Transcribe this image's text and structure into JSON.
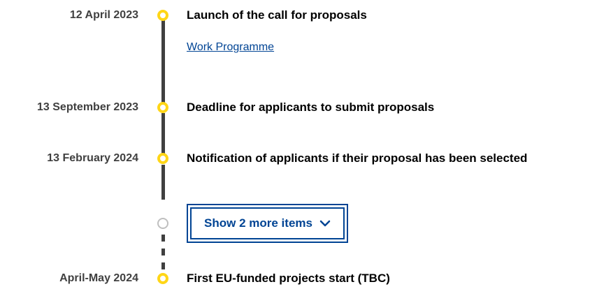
{
  "timeline": {
    "items": [
      {
        "date": "12 April 2023",
        "title": "Launch of the call for proposals",
        "link": "Work Programme"
      },
      {
        "date": "13 September 2023",
        "title": "Deadline for applicants to submit proposals"
      },
      {
        "date": "13 February 2024",
        "title": "Notification of applicants if their proposal has been selected"
      },
      {
        "date": "April-May 2024",
        "title": "First EU-funded projects start (TBC)"
      }
    ],
    "show_more_label": "Show 2 more items",
    "show_more_icon": "chevron-down-icon"
  },
  "colors": {
    "marker_active": "#ffd617",
    "marker_inactive": "#bfbfbf",
    "line": "#404040",
    "link": "#004494",
    "date_text": "#404040"
  }
}
